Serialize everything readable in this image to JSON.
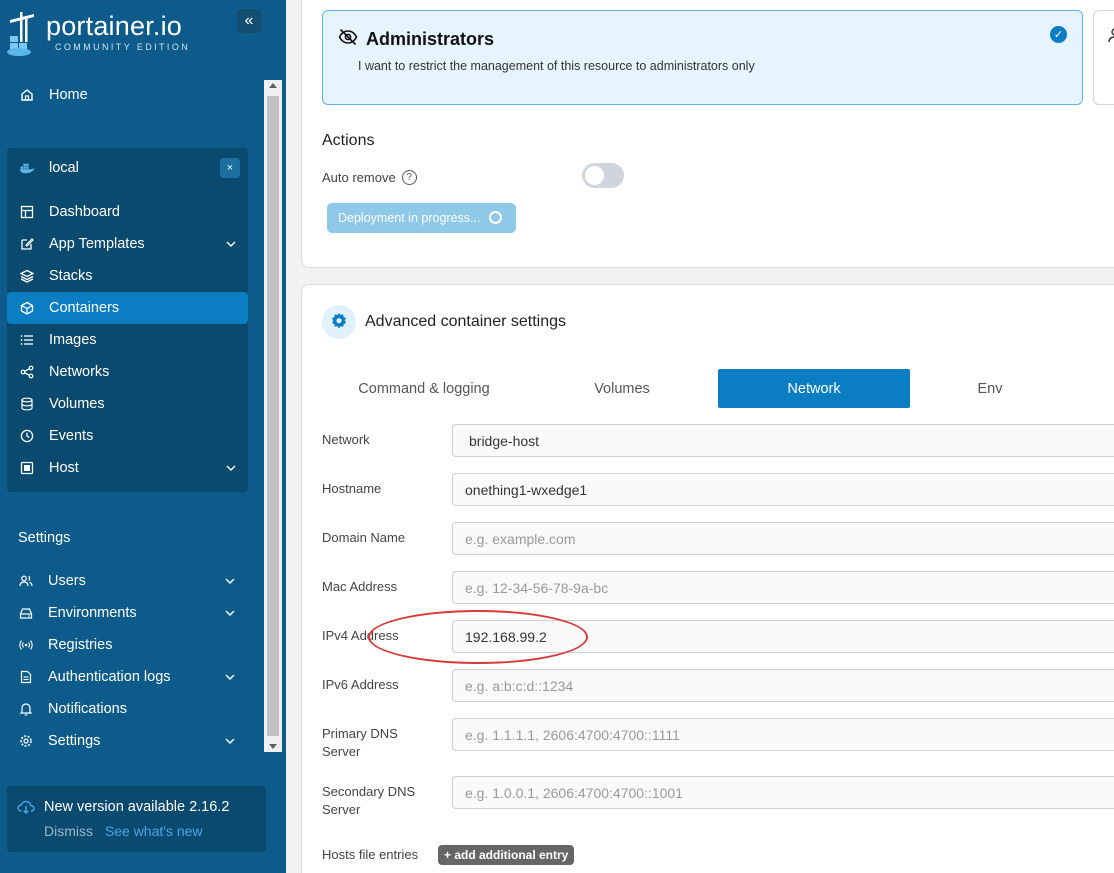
{
  "brand": {
    "title": "portainer.io",
    "subtitle": "COMMUNITY EDITION"
  },
  "sidebar": {
    "home": "Home",
    "environment": {
      "name": "local",
      "close": "×"
    },
    "env_items": [
      {
        "label": "Dashboard"
      },
      {
        "label": "App Templates"
      },
      {
        "label": "Stacks"
      },
      {
        "label": "Containers"
      },
      {
        "label": "Images"
      },
      {
        "label": "Networks"
      },
      {
        "label": "Volumes"
      },
      {
        "label": "Events"
      },
      {
        "label": "Host"
      }
    ],
    "settings_heading": "Settings",
    "settings_items": [
      {
        "label": "Users"
      },
      {
        "label": "Environments"
      },
      {
        "label": "Registries"
      },
      {
        "label": "Authentication logs"
      },
      {
        "label": "Notifications"
      },
      {
        "label": "Settings"
      }
    ],
    "update": {
      "title": "New version available 2.16.2",
      "dismiss": "Dismiss",
      "whats_new": "See what's new"
    }
  },
  "access": {
    "title": "Administrators",
    "description": "I want to restrict the management of this resource to administrators only"
  },
  "actions": {
    "title": "Actions",
    "auto_remove": "Auto remove",
    "auto_remove_enabled": false,
    "deploy_label": "Deployment in progress..."
  },
  "advanced": {
    "title": "Advanced container settings",
    "tabs": [
      "Command & logging",
      "Volumes",
      "Network",
      "Env"
    ],
    "active_tab": "Network"
  },
  "network_form": {
    "network": {
      "label": "Network",
      "value": "bridge-host"
    },
    "hostname": {
      "label": "Hostname",
      "value": "onething1-wxedge1"
    },
    "domain": {
      "label": "Domain Name",
      "placeholder": "e.g. example.com"
    },
    "mac": {
      "label": "Mac Address",
      "placeholder": "e.g. 12-34-56-78-9a-bc"
    },
    "ipv4": {
      "label": "IPv4 Address",
      "value": "192.168.99.2"
    },
    "ipv6": {
      "label": "IPv6 Address",
      "placeholder": "e.g. a:b:c:d::1234"
    },
    "primary_dns": {
      "label_line1": "Primary DNS",
      "label_line2": "Server",
      "placeholder": "e.g. 1.1.1.1, 2606:4700:4700::1111"
    },
    "secondary_dns": {
      "label_line1": "Secondary DNS",
      "label_line2": "Server",
      "placeholder": "e.g. 1.0.0.1, 2606:4700:4700::1001"
    },
    "hosts": {
      "label": "Hosts file entries",
      "add_label": "+ add additional entry"
    }
  },
  "colors": {
    "sidebar": "#0c5b8a",
    "accent": "#0b7dc2",
    "annotation": "#d83a3a"
  }
}
